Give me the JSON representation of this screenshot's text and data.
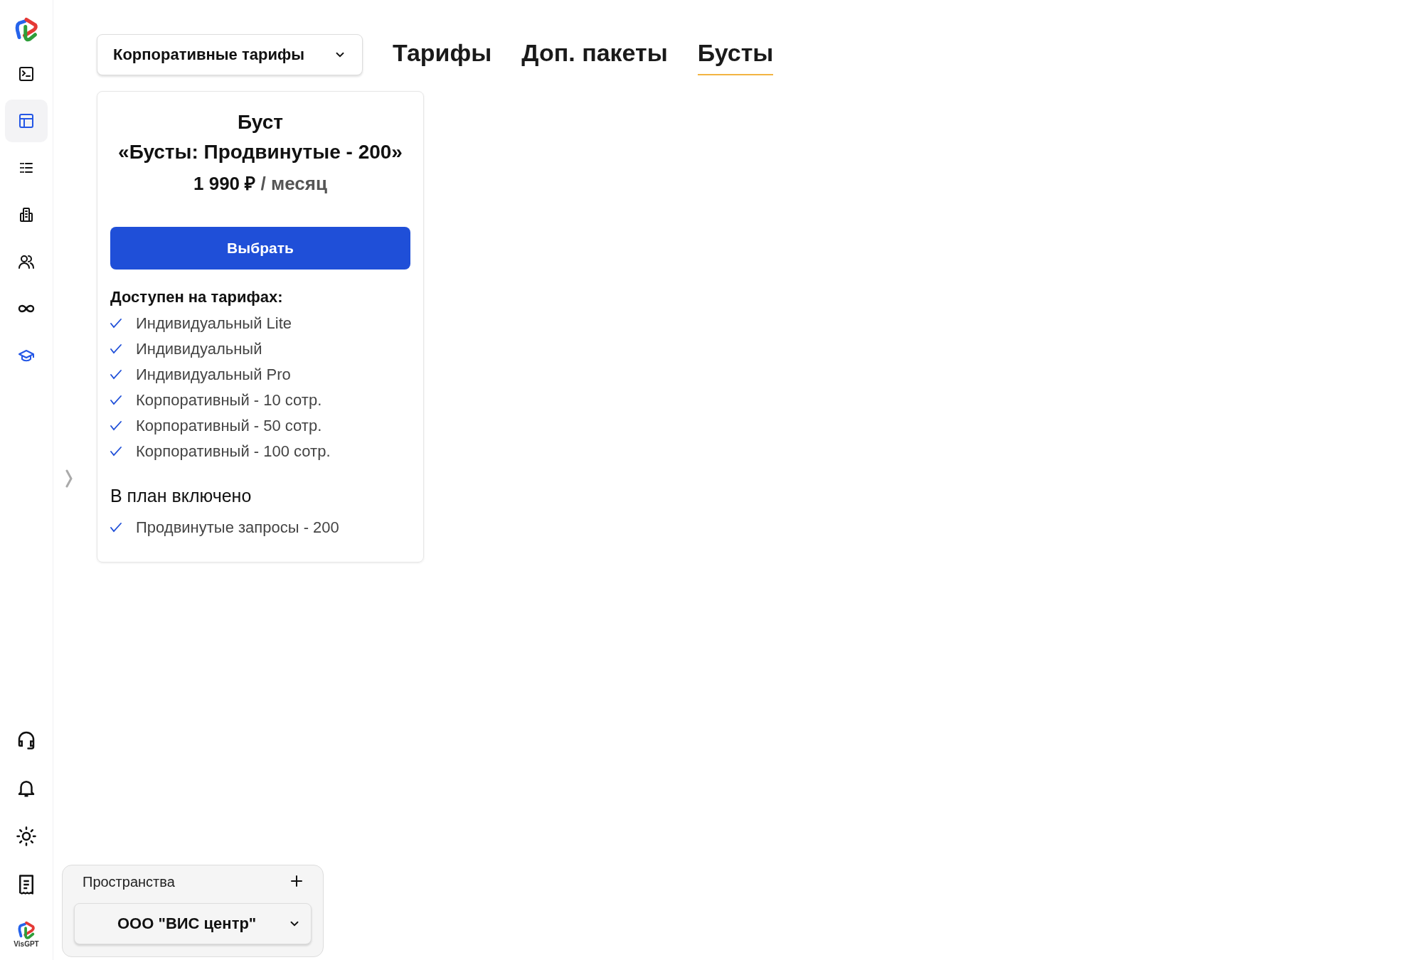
{
  "sidebar": {
    "nav_items": [
      {
        "kind": "terminal",
        "selected": false
      },
      {
        "kind": "table",
        "selected": true
      },
      {
        "kind": "list",
        "selected": false
      },
      {
        "kind": "building",
        "selected": false
      },
      {
        "kind": "users",
        "selected": false
      },
      {
        "kind": "infinity",
        "selected": false
      },
      {
        "kind": "education",
        "selected": false
      }
    ],
    "bottom_items": [
      {
        "kind": "headset"
      },
      {
        "kind": "bell"
      },
      {
        "kind": "sun"
      },
      {
        "kind": "receipt"
      },
      {
        "kind": "avatar",
        "label": "VisGPT"
      }
    ]
  },
  "plan_select": {
    "value": "Корпоративные тарифы"
  },
  "tabs": [
    {
      "label": "Тарифы",
      "selected": false
    },
    {
      "label": "Доп. пакеты",
      "selected": false
    },
    {
      "label": "Бусты",
      "selected": true
    }
  ],
  "card": {
    "title": "Буст",
    "subtitle": "«Бусты: Продвинутые - 200»",
    "price": "1 990 ₽",
    "period": "/ месяц",
    "button": "Выбрать",
    "available_heading": "Доступен на тарифах:",
    "available": [
      "Индивидуальный Lite",
      "Индивидуальный",
      "Индивидуальный Pro",
      "Корпоративный - 10 сотр.",
      "Корпоративный - 50 сотр.",
      "Корпоративный - 100 сотр."
    ],
    "included_heading": "В план включено",
    "included": [
      "Продвинутые запросы - 200"
    ]
  },
  "workspaces": {
    "title": "Пространства",
    "value": "ООО \"ВИС центр\""
  }
}
